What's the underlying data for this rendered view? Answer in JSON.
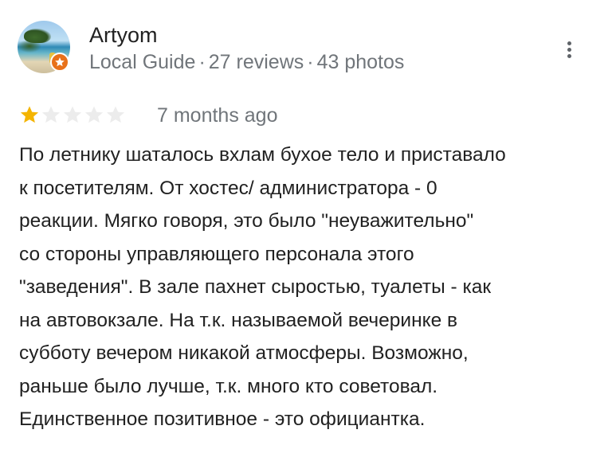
{
  "reviewer": {
    "name": "Artyom",
    "level": "Local Guide",
    "reviews": "27 reviews",
    "photos": "43 photos",
    "separator": "·",
    "avatar_icon": "beach-photo-avatar",
    "badge_icon": "local-guide-star-badge"
  },
  "menu": {
    "icon": "more-vert-icon"
  },
  "rating": {
    "stars_filled": 1,
    "stars_total": 5,
    "filled_color": "#f4b400",
    "empty_color": "#ececec"
  },
  "time_ago": "7 months ago",
  "review_text": "По летнику шаталось вхлам бухое тело и приставало\nк посетителям. От хостес/ администратора -  0\nреакции.  Мягко говоря, это было \"неуважительно\"\nсо стороны управляющего персонала этого\n\"заведения\". В зале пахнет сыростью, туалеты - как\nна автовокзале. На т.к. называемой вечеринке в\nсубботу вечером никакой атмосферы. Возможно,\nраньше было лучше, т.к. много кто советовал.\nЕдинственное позитивное - это официантка."
}
